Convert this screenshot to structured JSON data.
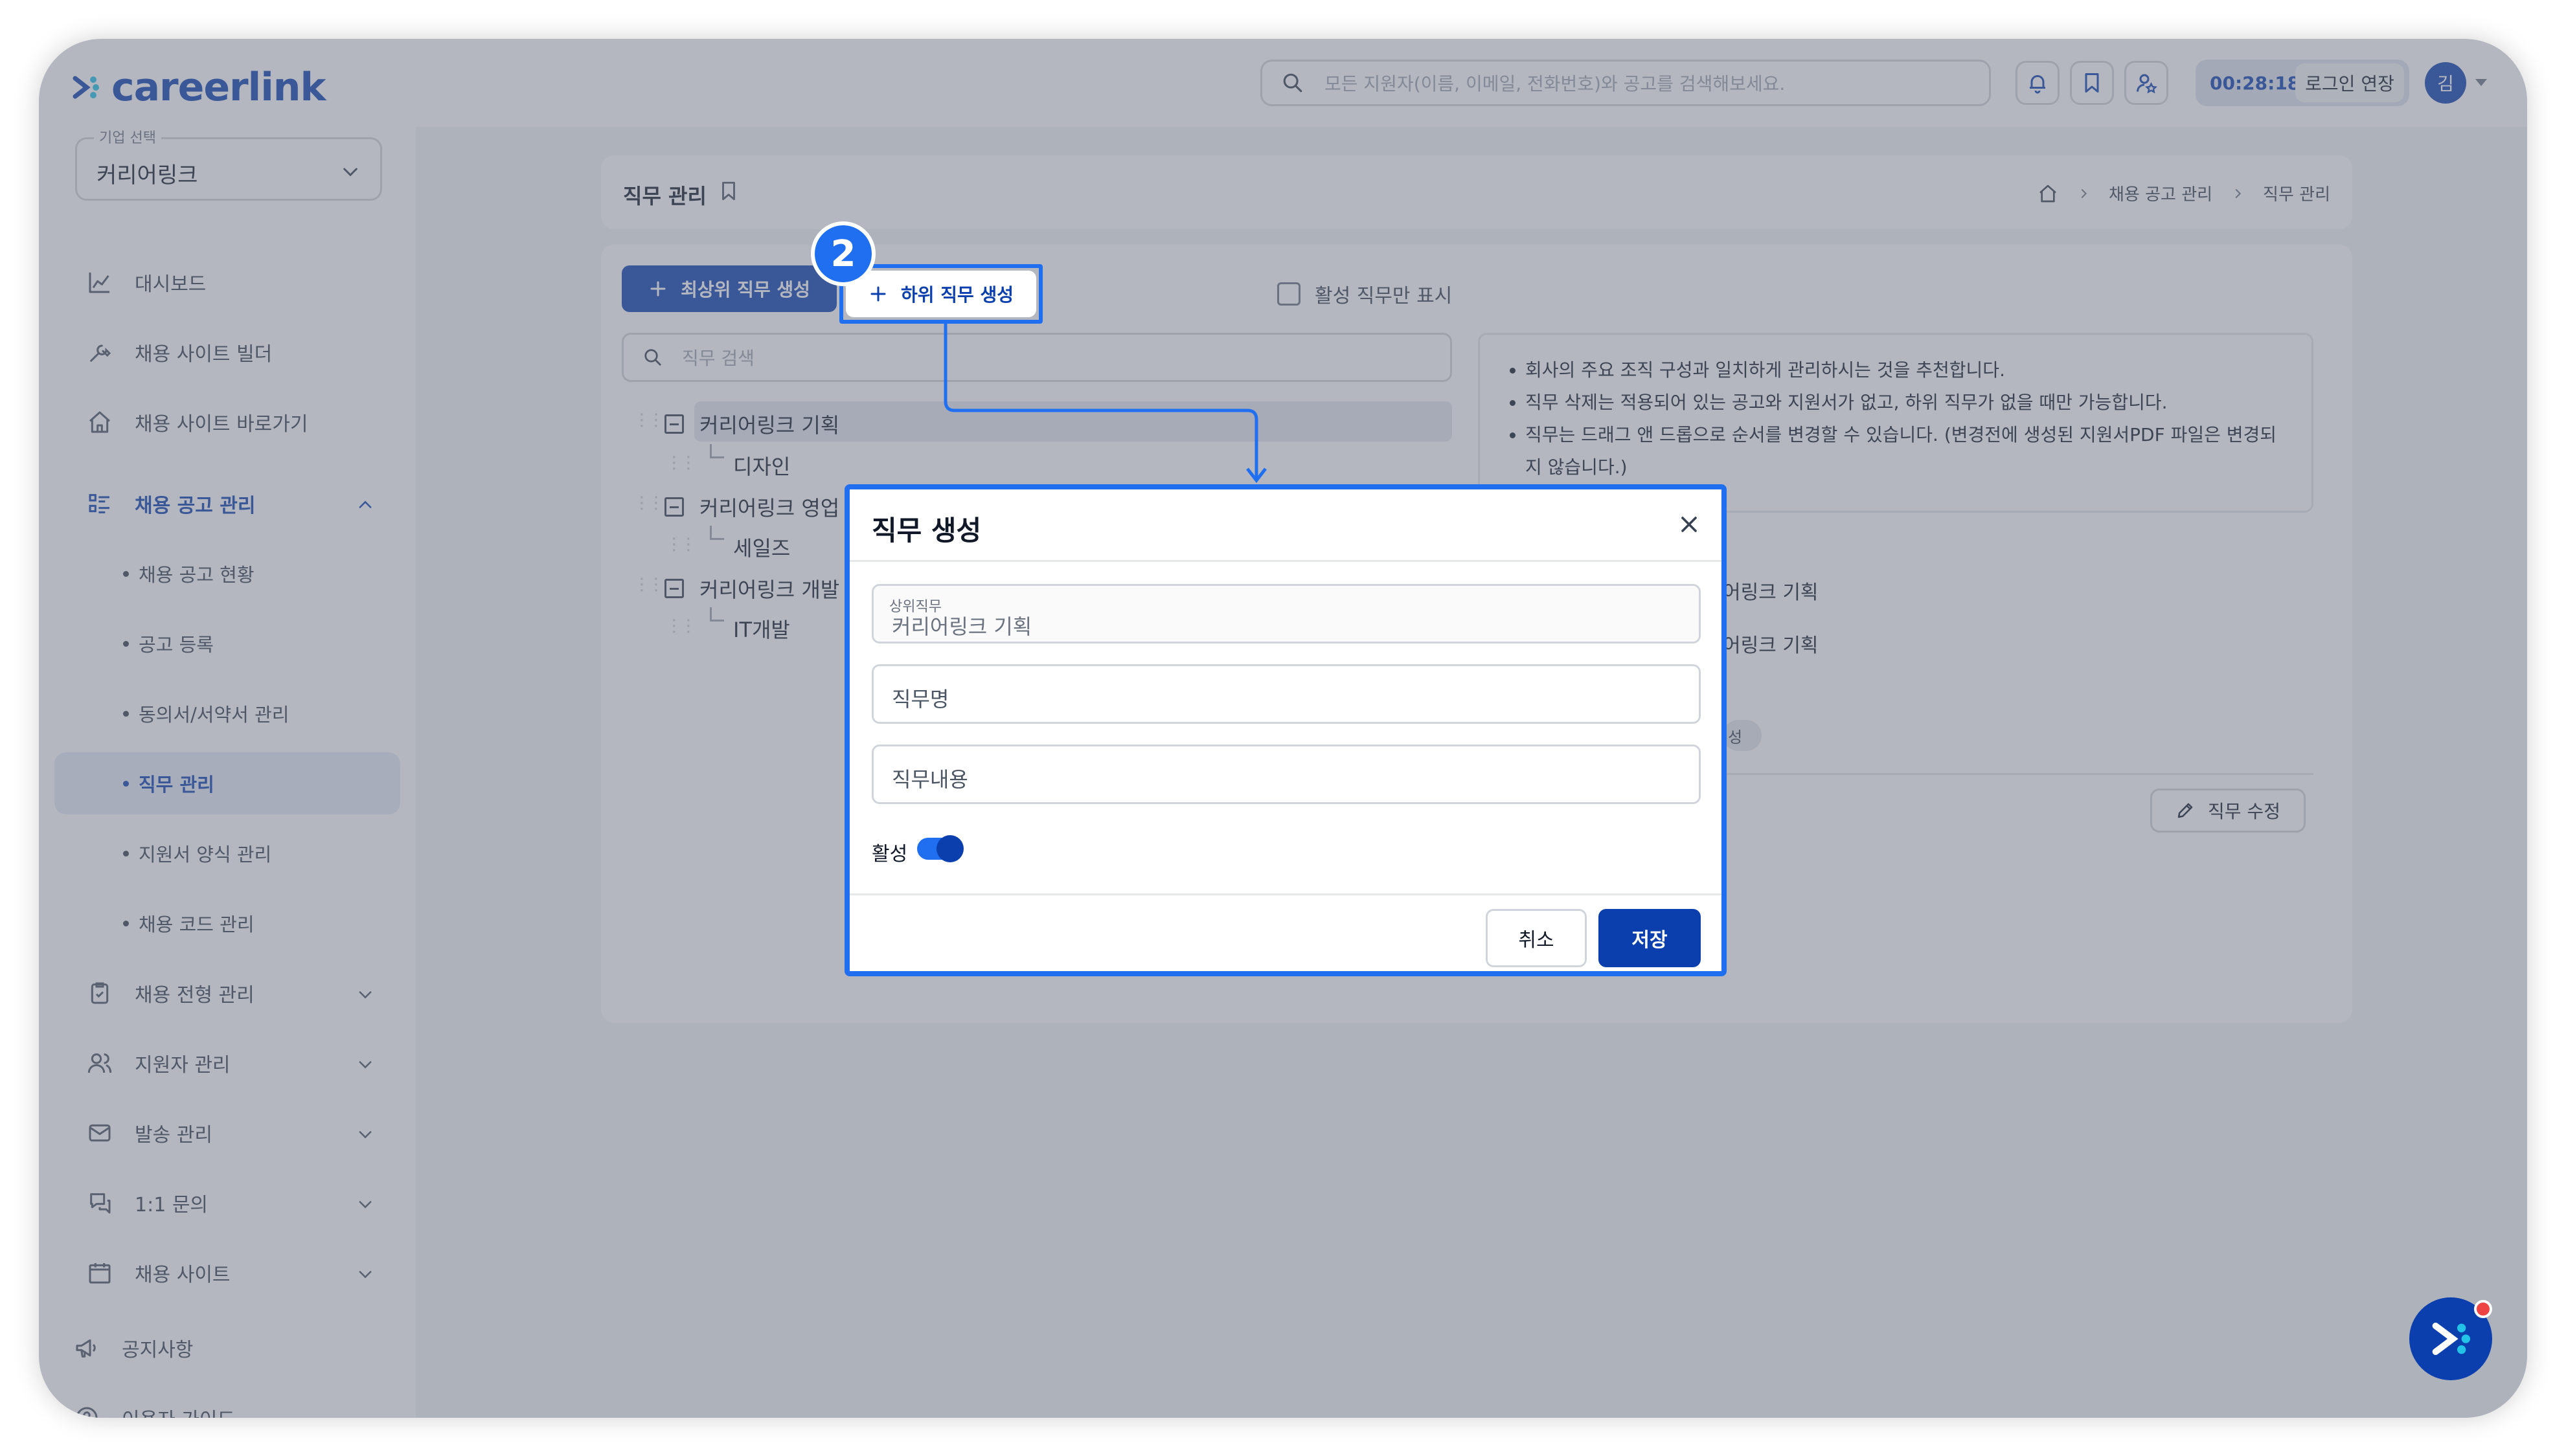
{
  "brand": {
    "name": "careerlink",
    "color": "#0b3fae"
  },
  "header": {
    "search_placeholder": "모든 지원자(이름, 이메일, 전화번호)와 공고를 검색해보세요.",
    "timer": "00:28:18",
    "extend_label": "로그인 연장",
    "avatar_initial": "김",
    "icons": [
      "bell-icon",
      "bookmark-icon",
      "user-star-icon"
    ]
  },
  "sidebar": {
    "company_label": "기업 선택",
    "company_value": "커리어링크",
    "items": [
      {
        "label": "대시보드",
        "icon": "chart-icon"
      },
      {
        "label": "채용 사이트 빌더",
        "icon": "tools-icon"
      },
      {
        "label": "채용 사이트 바로가기",
        "icon": "home-icon"
      },
      {
        "label": "채용 공고 관리",
        "icon": "list-icon"
      },
      {
        "label": "채용 전형 관리",
        "icon": "clipboard-icon"
      },
      {
        "label": "지원자 관리",
        "icon": "users-icon"
      },
      {
        "label": "발송 관리",
        "icon": "mail-icon"
      },
      {
        "label": "1:1 문의",
        "icon": "chat-icon"
      },
      {
        "label": "채용 사이트",
        "icon": "calendar-icon"
      },
      {
        "label": "공지사항",
        "icon": "megaphone-icon"
      },
      {
        "label": "이용자 가이드",
        "icon": "help-icon"
      }
    ],
    "subitems": [
      {
        "label": "채용 공고 현황"
      },
      {
        "label": "공고 등록"
      },
      {
        "label": "동의서/서약서 관리"
      },
      {
        "label": "직무 관리"
      },
      {
        "label": "지원서 양식 관리"
      },
      {
        "label": "채용 코드 관리"
      }
    ]
  },
  "page": {
    "title": "직무 관리",
    "breadcrumb": [
      "채용 공고 관리",
      "직무 관리"
    ]
  },
  "toolbar": {
    "create_top_label": "최상위 직무 생성",
    "create_sub_label": "하위 직무 생성",
    "active_only_label": "활성 직무만 표시",
    "step_number": "2"
  },
  "tree": {
    "search_placeholder": "직무 검색",
    "nodes": [
      {
        "label": "커리어링크 기획",
        "children": [
          "디자인"
        ]
      },
      {
        "label": "커리어링크 영업",
        "children": [
          "세일즈"
        ]
      },
      {
        "label": "커리어링크 개발",
        "children": [
          "IT개발"
        ]
      }
    ]
  },
  "info": {
    "notes": [
      "회사의 주요 조직 구성과 일치하게 관리하시는 것을 추천합니다.",
      "직무 삭제는 적용되어 있는 공고와 지원서가 없고, 하위 직무가 없을 때만 가능합니다.",
      "직무는 드래그 앤 드롭으로 순서를 변경할 수 있습니다. (변경전에 생성된 지원서PDF 파일은 변경되지 않습니다.)"
    ],
    "detail_line1": "어링크 기획",
    "detail_line2": "어링크 기획",
    "chip": "성",
    "edit_label": "직무 수정"
  },
  "modal": {
    "title": "직무 생성",
    "parent_label": "상위직무",
    "parent_value": "커리어링크 기획",
    "name_placeholder": "직무명",
    "content_placeholder": "직무내용",
    "active_label": "활성",
    "active": true,
    "cancel_label": "취소",
    "save_label": "저장"
  },
  "colors": {
    "accent": "#0b3fae",
    "highlight": "#1f6ff0"
  }
}
